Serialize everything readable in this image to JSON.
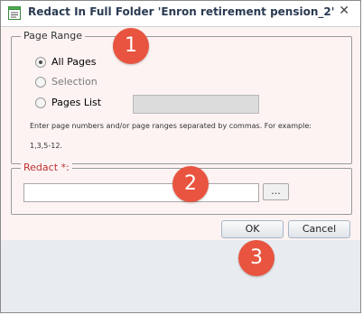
{
  "window": {
    "title": "Redact In Full Folder 'Enron retirement pension_2'",
    "close_glyph": "✕",
    "icon": "notepad-icon"
  },
  "page_range": {
    "legend": "Page Range",
    "options": [
      {
        "label": "All Pages",
        "selected": true,
        "enabled": true
      },
      {
        "label": "Selection",
        "selected": false,
        "enabled": false
      },
      {
        "label": "Pages List",
        "selected": false,
        "enabled": true
      }
    ],
    "pages_list_value": "",
    "hint_line1": "Enter page numbers and/or page ranges separated by commas. For example:",
    "hint_line2": "1,3,5-12."
  },
  "redact": {
    "legend": "Redact *:",
    "value": "",
    "browse_label": "..."
  },
  "buttons": {
    "ok": "OK",
    "cancel": "Cancel"
  },
  "callouts": [
    "1",
    "2",
    "3"
  ],
  "colors": {
    "callout": "#e8543f",
    "accent_title": "#2a3a52",
    "required": "#c03030"
  }
}
